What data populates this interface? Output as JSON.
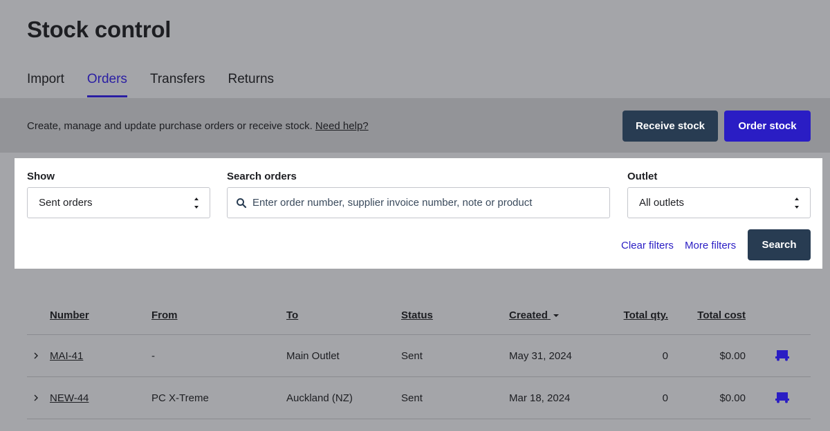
{
  "page": {
    "title": "Stock control"
  },
  "tabs": [
    {
      "label": "Import",
      "active": false
    },
    {
      "label": "Orders",
      "active": true
    },
    {
      "label": "Transfers",
      "active": false
    },
    {
      "label": "Returns",
      "active": false
    }
  ],
  "description": {
    "text": "Create, manage and update purchase orders or receive stock.",
    "help_link": "Need help?"
  },
  "actions": {
    "receive_label": "Receive stock",
    "order_label": "Order stock"
  },
  "filters": {
    "show_label": "Show",
    "show_value": "Sent orders",
    "search_label": "Search orders",
    "search_placeholder": "Enter order number, supplier invoice number, note or product",
    "outlet_label": "Outlet",
    "outlet_value": "All outlets",
    "clear_label": "Clear filters",
    "more_label": "More filters",
    "search_button": "Search"
  },
  "table": {
    "headers": {
      "number": "Number",
      "from": "From",
      "to": "To",
      "status": "Status",
      "created": "Created",
      "total_qty": "Total qty.",
      "total_cost": "Total cost"
    },
    "rows": [
      {
        "number": "MAI-41",
        "from": "-",
        "to": "Main Outlet",
        "status": "Sent",
        "created": "May 31, 2024",
        "qty": "0",
        "cost": "$0.00"
      },
      {
        "number": "NEW-44",
        "from": "PC X-Treme",
        "to": "Auckland (NZ)",
        "status": "Sent",
        "created": "Mar 18, 2024",
        "qty": "0",
        "cost": "$0.00"
      }
    ]
  },
  "colors": {
    "accent": "#2a1dc4",
    "primary_dark": "#283c52",
    "truck_icon": "#2a1dc4"
  },
  "icons": {
    "search": "search-icon",
    "row_expand": "chevron-right-icon",
    "row_action": "truck-icon",
    "sort": "caret-down-icon"
  }
}
